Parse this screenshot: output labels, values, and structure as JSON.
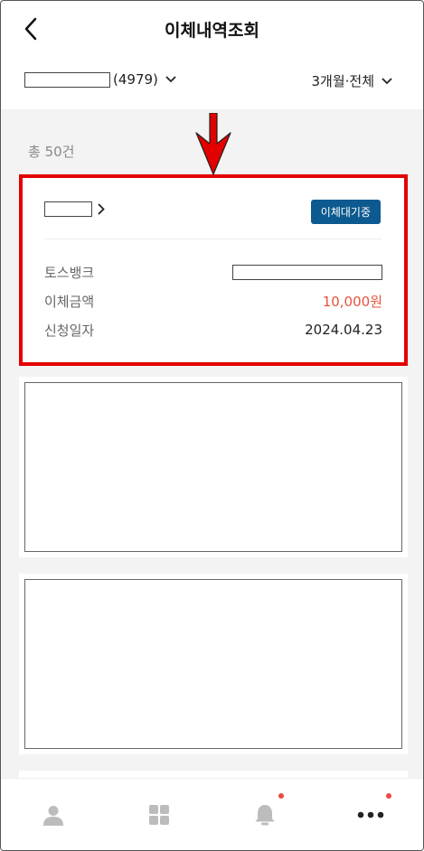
{
  "header": {
    "title": "이체내역조회"
  },
  "filter": {
    "account_suffix": "(4979)",
    "period_label": "3개월·전체"
  },
  "summary": {
    "total_count": "총 50건"
  },
  "first_item": {
    "status": "이체대기중",
    "rows": [
      {
        "label": "토스뱅크",
        "value": ""
      },
      {
        "label": "이체금액",
        "value": "10,000원"
      },
      {
        "label": "신청일자",
        "value": "2024.04.23"
      }
    ]
  },
  "colors": {
    "highlight": "#e30000",
    "badge": "#0c5a8f",
    "amount": "#e8533e"
  },
  "nav": [
    {
      "icon": "person-icon"
    },
    {
      "icon": "grid-icon"
    },
    {
      "icon": "bell-icon"
    },
    {
      "icon": "more-icon"
    }
  ]
}
